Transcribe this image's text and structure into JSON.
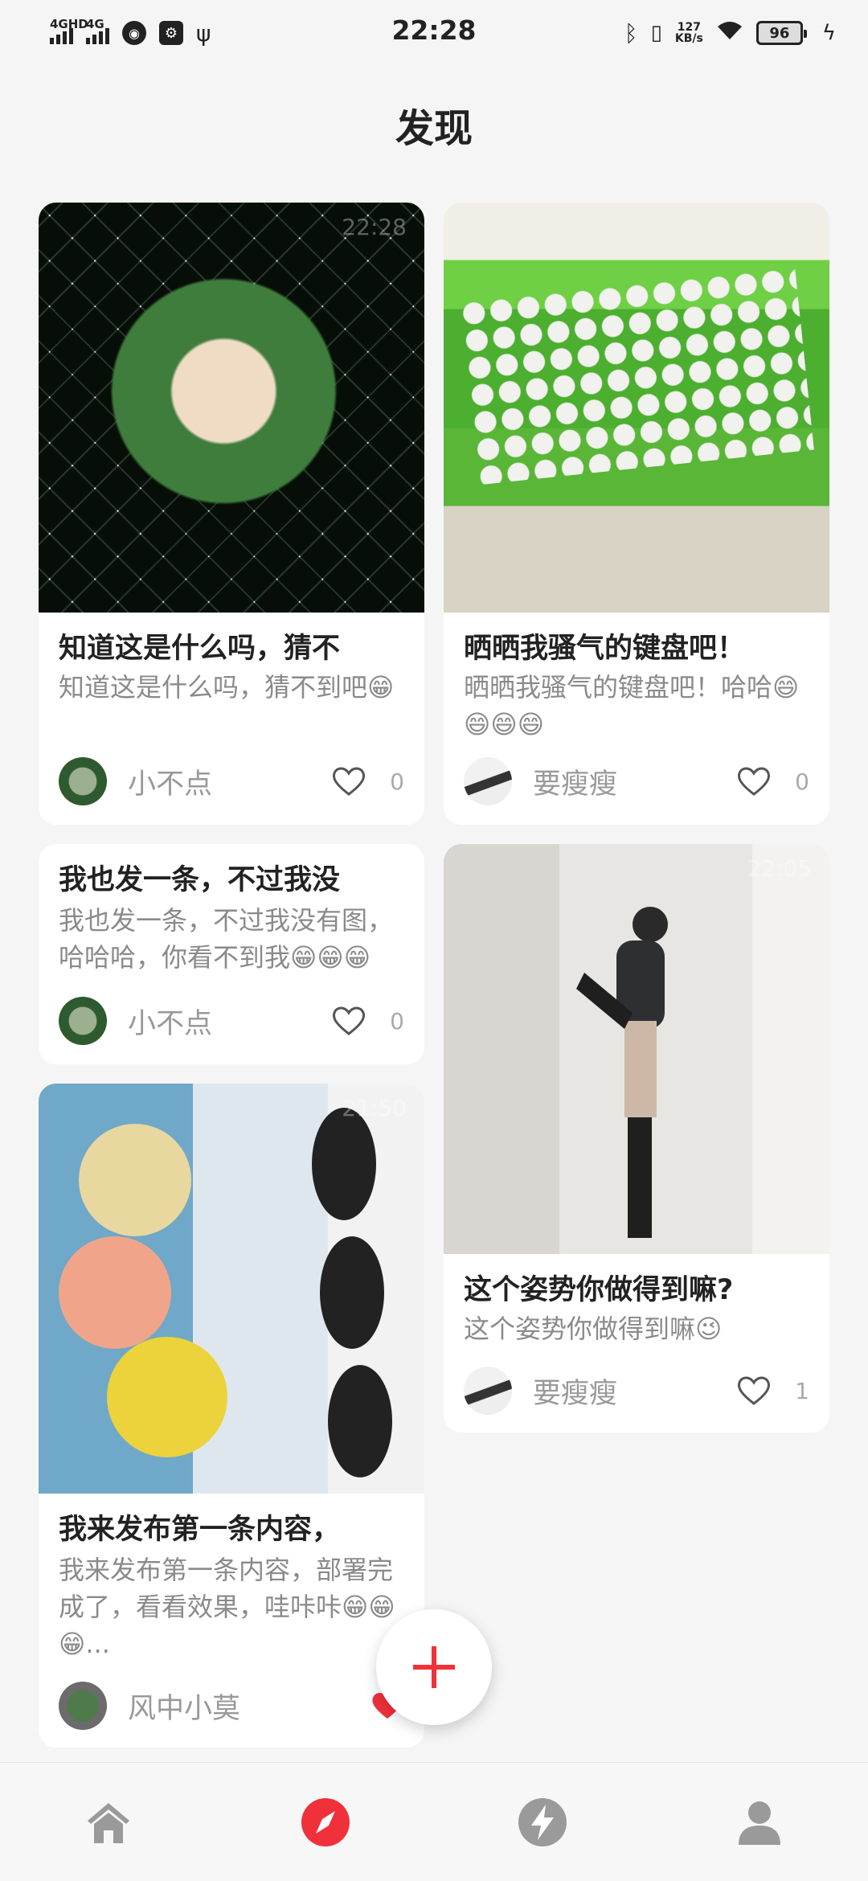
{
  "status_bar": {
    "time": "22:28",
    "signal_1": "4GHD",
    "signal_2": "4G",
    "net_speed_value": "127",
    "net_speed_unit": "KB/s",
    "battery": "96"
  },
  "page": {
    "title": "发现"
  },
  "cards": [
    {
      "title": "知道这是什么吗，猜不",
      "body": "知道这是什么吗，猜不到吧😁",
      "image_time": "22:28",
      "author": "小不点",
      "likes": "0",
      "liked": false
    },
    {
      "title": "晒晒我骚气的键盘吧！",
      "body": "晒晒我骚气的键盘吧！哈哈😄😄😄😄",
      "author": "要瘦瘦",
      "likes": "0",
      "liked": false
    },
    {
      "title": "我也发一条，不过我没",
      "body": "我也发一条，不过我没有图，哈哈哈，你看不到我😁😁😁",
      "author": "小不点",
      "likes": "0",
      "liked": false
    },
    {
      "title": "这个姿势你做得到嘛?",
      "body": "这个姿势你做得到嘛😉",
      "image_time": "22:05",
      "author": "要瘦瘦",
      "likes": "1",
      "liked": false
    },
    {
      "title": "我来发布第一条内容，",
      "body": "我来发布第一条内容，部署完成了，看看效果，哇咔咔😁😁😁...",
      "image_time": "21:50",
      "author": "风中小莫",
      "liked": true
    }
  ],
  "colors": {
    "accent": "#f0313a",
    "tab_inactive": "#9a9a9a"
  },
  "tabs": [
    {
      "icon": "home-icon",
      "active": false
    },
    {
      "icon": "compass-icon",
      "active": true
    },
    {
      "icon": "lightning-icon",
      "active": false
    },
    {
      "icon": "profile-icon",
      "active": false
    }
  ]
}
